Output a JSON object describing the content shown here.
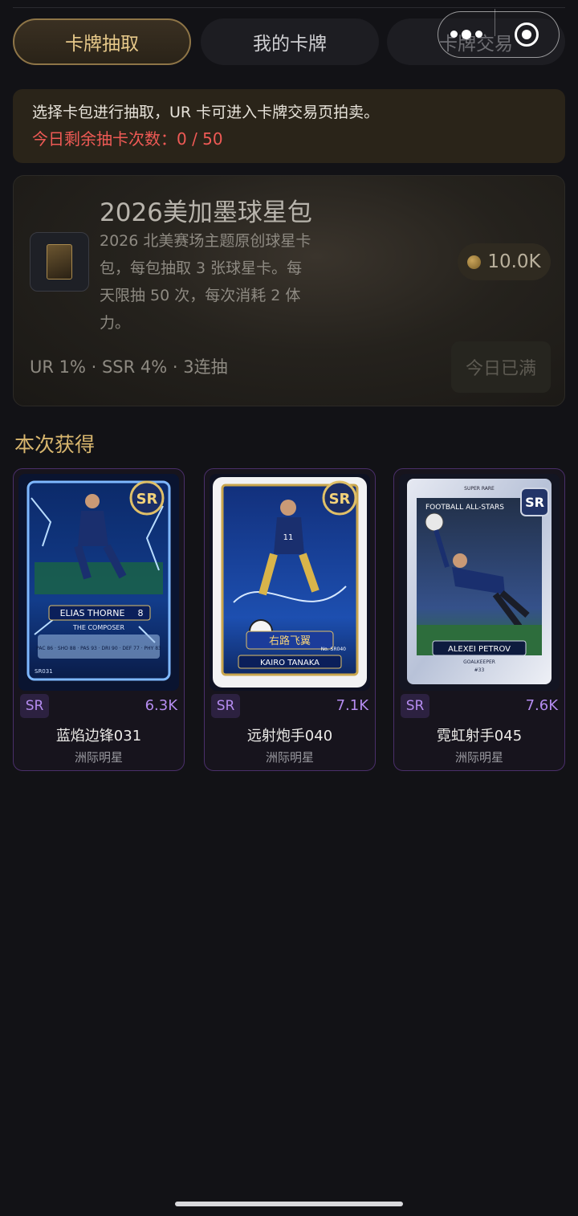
{
  "tabs": [
    {
      "label": "卡牌抽取",
      "active": true
    },
    {
      "label": "我的卡牌",
      "active": false
    },
    {
      "label": "卡牌交易",
      "active": false
    }
  ],
  "capsule": {
    "menu_icon": "more-dots-icon",
    "close_icon": "target-close-icon"
  },
  "notice": {
    "text": "选择卡包进行抽取，UR 卡可进入卡牌交易页拍卖。",
    "count_text": "今日剩余抽卡次数：0 / 50"
  },
  "pack": {
    "title": "2026美加墨球星包",
    "description": "2026 北美赛场主题原创球星卡包，每包抽取 3 张球星卡。每天限抽 50 次，每次消耗 2 体力。",
    "price": "10.0K",
    "odds": "UR 1% · SSR 4% · 3连抽",
    "button_label": "今日已满"
  },
  "section_title": "本次获得",
  "cards": [
    {
      "rarity": "SR",
      "value": "6.3K",
      "name": "蓝焰边锋031",
      "series": "洲际明星",
      "art": {
        "player_name": "ELIAS THORNE",
        "number": "8",
        "subtitle": "THE COMPOSER",
        "badge": "SR",
        "code": "SR031",
        "stats": "PAC 86 · SHO 88 · PAS 93 · DRI 90 · DEF 77 · PHY 83"
      }
    },
    {
      "rarity": "SR",
      "value": "7.1K",
      "name": "远射炮手040",
      "series": "洲际明星",
      "art": {
        "player_name": "KAIRO TANAKA",
        "number": "11",
        "subtitle": "右路飞翼",
        "badge": "SR",
        "code": "No. SR040"
      }
    },
    {
      "rarity": "SR",
      "value": "7.6K",
      "name": "霓虹射手045",
      "series": "洲际明星",
      "art": {
        "player_name": "ALEXEI PETROV",
        "number": "#33",
        "subtitle": "GOALKEEPER",
        "badge": "SR",
        "header": "FOOTBALL ALL-STARS",
        "super": "SUPER RARE"
      }
    }
  ],
  "colors": {
    "accent_gold": "#d8b66e",
    "rarity_purple": "#b58cf0",
    "warning_red": "#ef5a55"
  }
}
